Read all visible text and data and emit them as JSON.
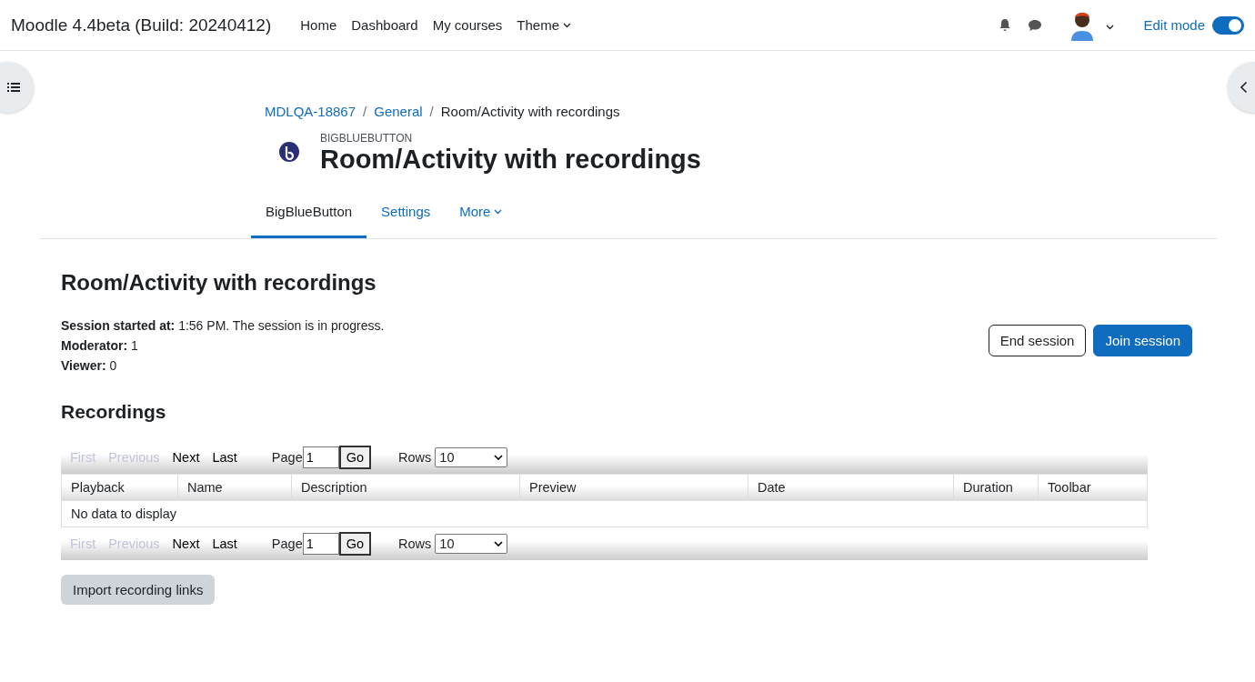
{
  "navbar": {
    "site_name": "Moodle 4.4beta (Build: 20240412)",
    "links": [
      {
        "label": "Home",
        "dropdown": false
      },
      {
        "label": "Dashboard",
        "dropdown": false
      },
      {
        "label": "My courses",
        "dropdown": false
      },
      {
        "label": "Theme",
        "dropdown": true
      }
    ],
    "edit_mode": {
      "label": "Edit mode",
      "on": true
    }
  },
  "breadcrumb": [
    {
      "label": "MDLQA-18867",
      "kind": "link"
    },
    {
      "separator": "/",
      "label": "General",
      "kind": "link"
    },
    {
      "separator": "/",
      "label": "Room/Activity with recordings",
      "kind": "current"
    }
  ],
  "activity": {
    "type_label": "BIGBLUEBUTTON",
    "title": "Room/Activity with recordings"
  },
  "tabs": [
    {
      "label": "BigBlueButton",
      "selected": true,
      "dropdown": false
    },
    {
      "label": "Settings",
      "selected": false,
      "dropdown": false
    },
    {
      "label": "More",
      "selected": false,
      "dropdown": true
    }
  ],
  "page_heading": "Room/Activity with recordings",
  "session_info": [
    "**Session started at:** 1:56 PM. The session is in progress.",
    "**Moderator:** 1",
    "**Viewer:** 0"
  ],
  "session_buttons": [
    {
      "label": "End session",
      "kind": "outline"
    },
    {
      "label": "Join session",
      "kind": "primary"
    }
  ],
  "recordings": {
    "heading": "Recordings",
    "pagers": [
      {
        "links": [
          {
            "label": "First",
            "disabled": true
          },
          {
            "label": "Previous",
            "disabled": true
          },
          {
            "label": "Next",
            "disabled": false
          },
          {
            "label": "Last",
            "disabled": false
          }
        ],
        "page_label": "Page",
        "page_value": "1",
        "go_label": "Go",
        "rows_label": "Rows",
        "rows_value": "10"
      },
      {
        "links": [
          {
            "label": "First",
            "disabled": true
          },
          {
            "label": "Previous",
            "disabled": true
          },
          {
            "label": "Next",
            "disabled": false
          },
          {
            "label": "Last",
            "disabled": false
          }
        ],
        "page_label": "Page",
        "page_value": "1",
        "go_label": "Go",
        "rows_label": "Rows",
        "rows_value": "10"
      }
    ],
    "columns": [
      "Playback",
      "Name",
      "Description",
      "Preview",
      "Date",
      "Duration",
      "Toolbar"
    ],
    "empty_message": "No data to display"
  },
  "import_button": {
    "label": "Import recording links"
  }
}
